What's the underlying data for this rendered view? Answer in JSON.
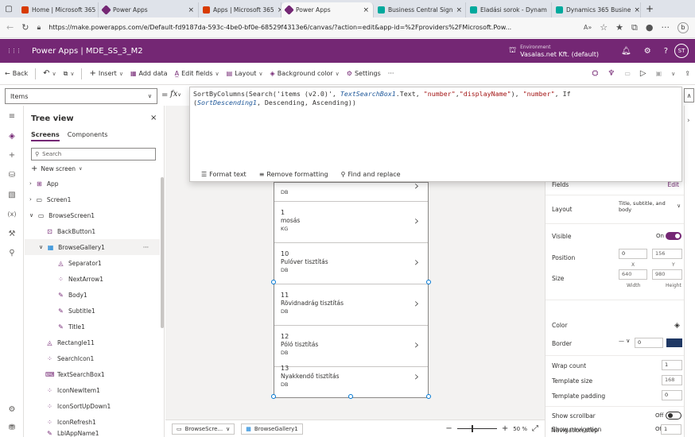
{
  "browser": {
    "tabs": [
      {
        "label": "Home | Microsoft 365",
        "close": "×",
        "color": "#d83b01"
      },
      {
        "label": "Power Apps",
        "close": "×",
        "color": "#742774"
      },
      {
        "label": "Apps | Microsoft 365",
        "close": "×",
        "color": "#d83b01"
      },
      {
        "label": "Power Apps",
        "close": "×",
        "color": "#742774"
      },
      {
        "label": "Business Central Sign",
        "close": "×",
        "color": "#00a99d"
      },
      {
        "label": "Eladási sorok - Dynam",
        "close": "×",
        "color": "#00a99d"
      },
      {
        "label": "Dynamics 365 Busine",
        "close": "×",
        "color": "#00a99d"
      }
    ],
    "new_tab": "+",
    "url": "https://make.powerapps.com/e/Default-fd9187da-593c-4be0-bf0e-68529f4313e6/canvas/?action=edit&app-id=%2Fproviders%2FMicrosoft.Pow..."
  },
  "app": {
    "waffle": "⋮⋮⋮",
    "title": "Power Apps  |  MDE_SS_3_M2",
    "environment_label": "Environment",
    "environment_name": "Vasalas.net Kft. (default)",
    "avatar": "ST"
  },
  "commands": {
    "back": "Back",
    "insert": "Insert",
    "add_data": "Add data",
    "edit_fields": "Edit fields",
    "layout": "Layout",
    "background_color": "Background color",
    "settings": "Settings",
    "more": "···"
  },
  "formula_bar": {
    "property": "Items",
    "eq": "=",
    "fx": "fx",
    "line1_a": "SortByColumns(Search('items (v2.0)', ",
    "line1_ctl": "TextSearchBox1",
    "line1_b": ".Text, ",
    "line1_s1": "\"number\"",
    "line1_c": ",",
    "line1_s2": "\"displayName\"",
    "line1_d": "), ",
    "line1_s3": "\"number\"",
    "line1_e": ", If",
    "line2_a": "(",
    "line2_ctl": "SortDescending1",
    "line2_b": ", Descending, Ascending))",
    "format_text": "Format text",
    "remove_formatting": "Remove formatting",
    "find_replace": "Find and replace"
  },
  "tree": {
    "title": "Tree view",
    "close": "×",
    "tabs": [
      "Screens",
      "Components"
    ],
    "search_placeholder": "Search",
    "new_screen": "New screen",
    "nodes": [
      {
        "label": "App"
      },
      {
        "label": "Screen1"
      },
      {
        "label": "BrowseScreen1"
      },
      {
        "label": "BackButton1"
      },
      {
        "label": "BrowseGallery1",
        "more": "···"
      },
      {
        "label": "Separator1"
      },
      {
        "label": "NextArrow1"
      },
      {
        "label": "Body1"
      },
      {
        "label": "Subtitle1"
      },
      {
        "label": "Title1"
      },
      {
        "label": "Rectangle11"
      },
      {
        "label": "SearchIcon1"
      },
      {
        "label": "TextSearchBox1"
      },
      {
        "label": "IconNewItem1"
      },
      {
        "label": "IconSortUpDown1"
      },
      {
        "label": "IconRefresh1"
      },
      {
        "label": "LblAppName1"
      }
    ]
  },
  "gallery": {
    "items": [
      {
        "number": "",
        "name": "",
        "unit": "DB"
      },
      {
        "number": "1",
        "name": "mosás",
        "unit": "KG"
      },
      {
        "number": "10",
        "name": "Pulóver tisztítás",
        "unit": "DB"
      },
      {
        "number": "11",
        "name": "Rövidnadrág tisztítás",
        "unit": "DB"
      },
      {
        "number": "12",
        "name": "Póló tisztítás",
        "unit": "DB"
      },
      {
        "number": "13",
        "name": "Nyakkendő tisztítás",
        "unit": "DB"
      }
    ]
  },
  "status": {
    "screen": "BrowseScre...",
    "control": "BrowseGallery1",
    "zoom_minus": "−",
    "zoom_plus": "+",
    "zoom": "50 %"
  },
  "properties": {
    "fields": "Fields",
    "edit": "Edit",
    "layout": "Layout",
    "layout_value": "Title, subtitle, and body",
    "visible": "Visible",
    "visible_state": "On",
    "position": "Position",
    "pos_x": "0",
    "pos_y": "156",
    "x_label": "X",
    "y_label": "Y",
    "size": "Size",
    "width": "640",
    "height": "980",
    "width_label": "Width",
    "height_label": "Height",
    "color": "Color",
    "border": "Border",
    "border_width": "0",
    "border_color": "#1f3864",
    "wrap_count": "Wrap count",
    "wrap_count_value": "1",
    "template_size": "Template size",
    "template_size_value": "168",
    "template_padding": "Template padding",
    "template_padding_value": "0",
    "show_scrollbar": "Show scrollbar",
    "show_scrollbar_state": "Off",
    "show_navigation": "Show navigation",
    "show_navigation_state": "Off",
    "navigation_step": "Navigation step",
    "navigation_step_value": "1"
  },
  "colors": {
    "brand": "#742774",
    "selection": "#0078d4"
  }
}
